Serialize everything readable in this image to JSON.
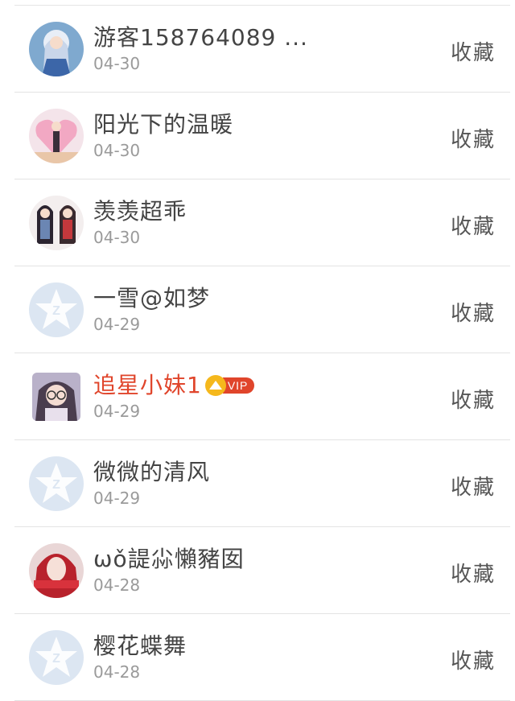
{
  "list": {
    "items": [
      {
        "name": "游客158764089 ...",
        "date": "04-30",
        "action": "收藏",
        "avatar_icon": "girl-anime-avatar-icon"
      },
      {
        "name": "阳光下的温暖",
        "date": "04-30",
        "action": "收藏",
        "avatar_icon": "girl-heart-avatar-icon"
      },
      {
        "name": "羡羡超乖",
        "date": "04-30",
        "action": "收藏",
        "avatar_icon": "couple-avatar-icon"
      },
      {
        "name": "一雪@如梦",
        "date": "04-29",
        "action": "收藏",
        "avatar_icon": "default-qq-avatar-icon"
      },
      {
        "name": "追星小妹1",
        "date": "04-29",
        "action": "收藏",
        "avatar_icon": "girl-glasses-avatar-icon",
        "vip_label": "VIP"
      },
      {
        "name": "微微的清风",
        "date": "04-29",
        "action": "收藏",
        "avatar_icon": "default-qq-avatar-icon"
      },
      {
        "name": "ωǒ諟尛懶豬囡",
        "date": "04-28",
        "action": "收藏",
        "avatar_icon": "red-hair-avatar-icon"
      },
      {
        "name": "樱花蝶舞",
        "date": "04-28",
        "action": "收藏",
        "avatar_icon": "default-qq-avatar-icon"
      }
    ]
  },
  "colors": {
    "name": "#444444",
    "vip_name": "#e0452b",
    "date": "#9a9a9a",
    "divider": "#e3e3e3",
    "default_avatar": "#dce6f2"
  }
}
